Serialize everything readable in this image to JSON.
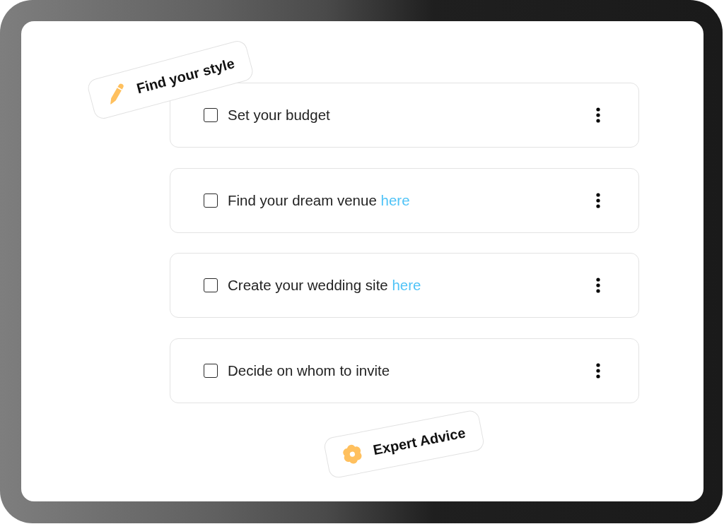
{
  "style_badge": {
    "label": "Find your style"
  },
  "tasks": [
    {
      "text": "Set your budget",
      "checked": false
    },
    {
      "text": "Find your dream venue",
      "link": "here",
      "checked": false
    },
    {
      "text": "Create your wedding site",
      "link": "here",
      "checked": false
    },
    {
      "text": "Decide on whom to invite",
      "checked": false
    }
  ],
  "advice_badge": {
    "label": "Expert Advice"
  }
}
